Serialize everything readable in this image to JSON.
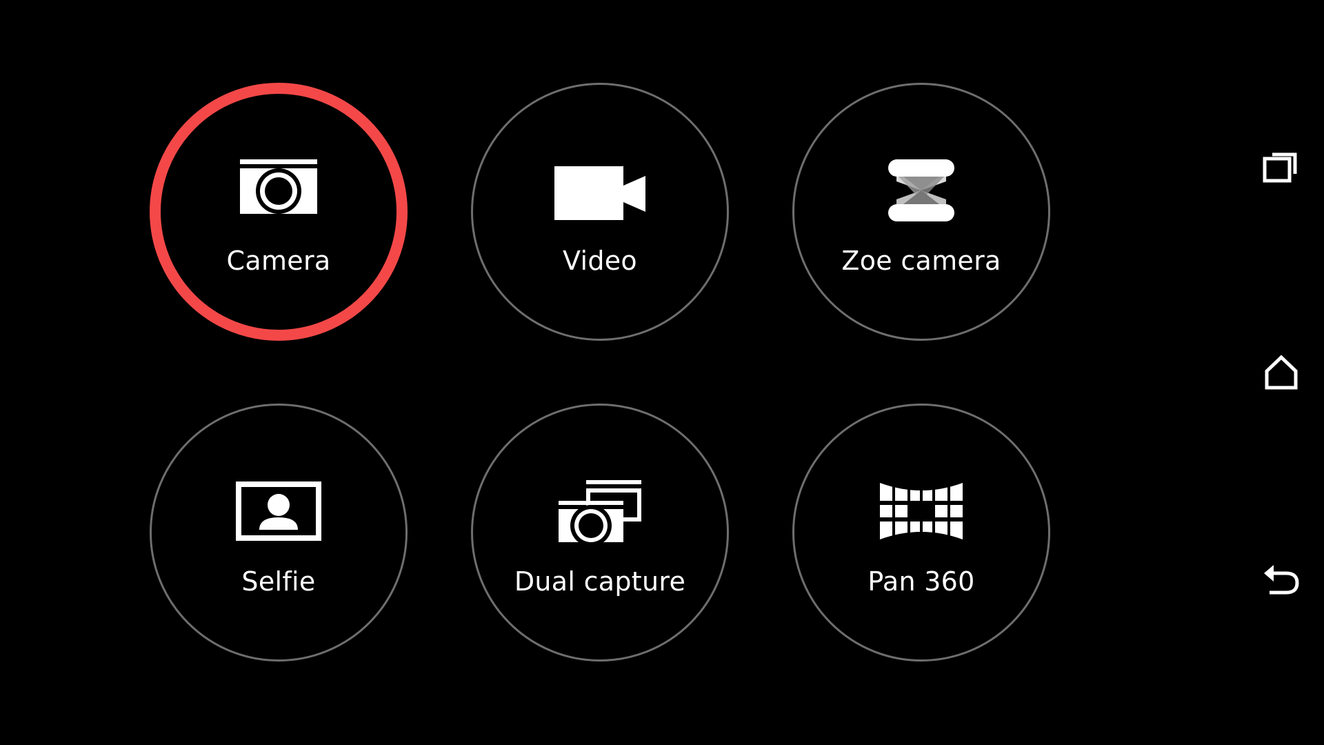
{
  "modes": [
    {
      "label": "Camera",
      "icon": "camera-icon",
      "selected": true
    },
    {
      "label": "Video",
      "icon": "video-camera-icon",
      "selected": false
    },
    {
      "label": "Zoe camera",
      "icon": "zoe-icon",
      "selected": false
    },
    {
      "label": "Selfie",
      "icon": "selfie-icon",
      "selected": false
    },
    {
      "label": "Dual capture",
      "icon": "dual-capture-icon",
      "selected": false
    },
    {
      "label": "Pan 360",
      "icon": "pan-360-icon",
      "selected": false
    }
  ],
  "navigation": {
    "recent_apps": "recent-apps-icon",
    "home": "home-icon",
    "back": "back-icon"
  },
  "colors": {
    "background": "#000000",
    "selected_ring": "#f44848",
    "ring": "#6e6e6e",
    "text": "#ffffff"
  }
}
